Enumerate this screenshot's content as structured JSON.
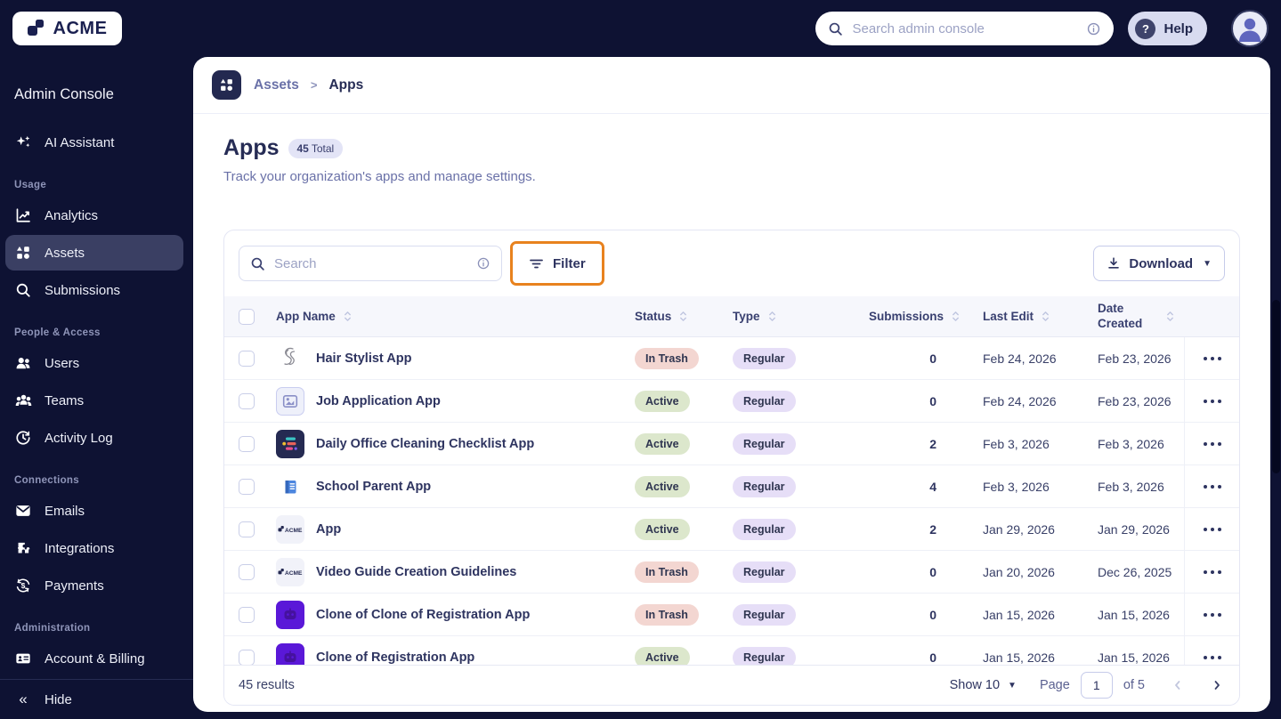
{
  "topbar": {
    "logo_text": "ACME",
    "search_placeholder": "Search admin console",
    "help_label": "Help"
  },
  "sidebar": {
    "title": "Admin Console",
    "assistant_label": "AI Assistant",
    "sections": [
      {
        "label": "Usage",
        "items": [
          {
            "label": "Analytics"
          },
          {
            "label": "Assets",
            "active": true
          },
          {
            "label": "Submissions"
          }
        ]
      },
      {
        "label": "People & Access",
        "items": [
          {
            "label": "Users"
          },
          {
            "label": "Teams"
          },
          {
            "label": "Activity Log"
          }
        ]
      },
      {
        "label": "Connections",
        "items": [
          {
            "label": "Emails"
          },
          {
            "label": "Integrations"
          },
          {
            "label": "Payments"
          }
        ]
      },
      {
        "label": "Administration",
        "items": [
          {
            "label": "Account & Billing"
          }
        ]
      }
    ],
    "hide_label": "Hide"
  },
  "breadcrumb": {
    "parent": "Assets",
    "separator": ">",
    "current": "Apps"
  },
  "page": {
    "title": "Apps",
    "badge_count": "45",
    "badge_label": "Total",
    "subtitle": "Track your organization's apps and manage settings."
  },
  "toolbar": {
    "search_placeholder": "Search",
    "filter_label": "Filter",
    "download_label": "Download",
    "highlight_color": "#E8821E"
  },
  "table": {
    "columns": [
      "App Name",
      "Status",
      "Type",
      "Submissions",
      "Last Edit",
      "Date Created"
    ],
    "rows": [
      {
        "name": "Hair Stylist App",
        "icon": "hair-stylist-app-icon",
        "status": "In Trash",
        "type": "Regular",
        "submissions": "0",
        "last_edit": "Feb 24, 2026",
        "date_created": "Feb 23, 2026"
      },
      {
        "name": "Job Application App",
        "icon": "job-application-app-icon",
        "status": "Active",
        "type": "Regular",
        "submissions": "0",
        "last_edit": "Feb 24, 2026",
        "date_created": "Feb 23, 2026"
      },
      {
        "name": "Daily Office Cleaning Checklist App",
        "icon": "cleaning-checklist-app-icon",
        "status": "Active",
        "type": "Regular",
        "submissions": "2",
        "last_edit": "Feb 3, 2026",
        "date_created": "Feb 3, 2026"
      },
      {
        "name": "School Parent App",
        "icon": "school-parent-app-icon",
        "status": "Active",
        "type": "Regular",
        "submissions": "4",
        "last_edit": "Feb 3, 2026",
        "date_created": "Feb 3, 2026"
      },
      {
        "name": "App",
        "icon": "acme-app-icon",
        "status": "Active",
        "type": "Regular",
        "submissions": "2",
        "last_edit": "Jan 29, 2026",
        "date_created": "Jan 29, 2026"
      },
      {
        "name": "Video Guide Creation Guidelines",
        "icon": "acme-app-icon",
        "status": "In Trash",
        "type": "Regular",
        "submissions": "0",
        "last_edit": "Jan 20, 2026",
        "date_created": "Dec 26, 2025"
      },
      {
        "name": "Clone of Clone of Registration App",
        "icon": "registration-app-icon",
        "status": "In Trash",
        "type": "Regular",
        "submissions": "0",
        "last_edit": "Jan 15, 2026",
        "date_created": "Jan 15, 2026"
      },
      {
        "name": "Clone of Registration App",
        "icon": "registration-app-icon",
        "status": "Active",
        "type": "Regular",
        "submissions": "0",
        "last_edit": "Jan 15, 2026",
        "date_created": "Jan 15, 2026"
      }
    ]
  },
  "footer": {
    "results": "45 results",
    "show_label": "Show 10",
    "page_label": "Page",
    "page_value": "1",
    "of_label": "of 5"
  },
  "colors": {
    "background": "#0E1233",
    "card": "#FFFFFF",
    "accent_highlight": "#E8821E",
    "status_in_trash_bg": "#F3D6D1",
    "status_active_bg": "#DCE7CC",
    "type_regular_bg": "#E6DEF7",
    "sidebar_active_bg": "#3A3F63",
    "text_primary": "#2E3460",
    "text_muted": "#6A71A8"
  }
}
